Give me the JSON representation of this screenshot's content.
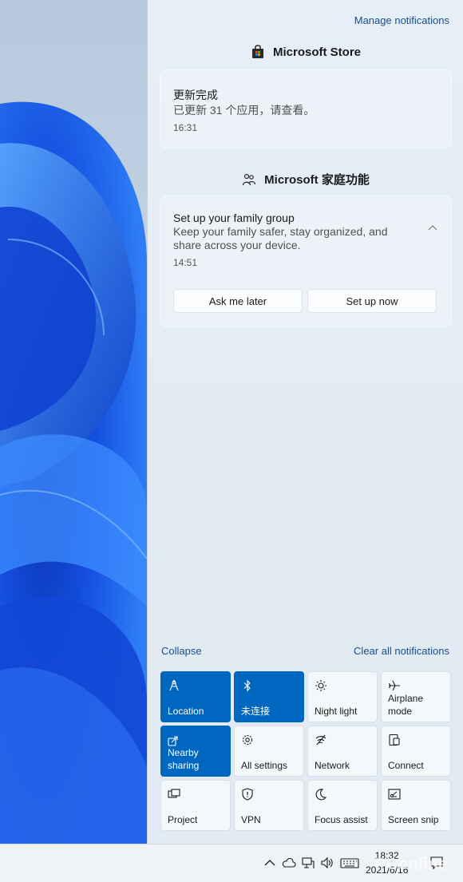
{
  "panel": {
    "manage_label": "Manage notifications",
    "collapse_label": "Collapse",
    "clear_all_label": "Clear all notifications"
  },
  "groups": [
    {
      "app": "Microsoft Store",
      "icon": "store-bag-icon",
      "notification": {
        "title": "更新完成",
        "body": "已更新 31 个应用，请查看。",
        "time": "16:31"
      }
    },
    {
      "app": "Microsoft 家庭功能",
      "icon": "family-icon",
      "notification": {
        "title": "Set up your family group",
        "body": "Keep your family safer, stay organized, and share across your device.",
        "time": "14:51",
        "buttons": [
          "Ask me later",
          "Set up now"
        ]
      }
    }
  ],
  "quick_actions": [
    {
      "label": "Location",
      "icon": "location-icon",
      "on": true
    },
    {
      "label": "未连接",
      "icon": "bluetooth-icon",
      "on": true
    },
    {
      "label": "Night light",
      "icon": "night-light-icon",
      "on": false
    },
    {
      "label": "Airplane mode",
      "icon": "airplane-icon",
      "on": false
    },
    {
      "label": "Nearby sharing",
      "icon": "nearby-sharing-icon",
      "on": true
    },
    {
      "label": "All settings",
      "icon": "gear-icon",
      "on": false
    },
    {
      "label": "Network",
      "icon": "network-icon",
      "on": false
    },
    {
      "label": "Connect",
      "icon": "connect-icon",
      "on": false
    },
    {
      "label": "Project",
      "icon": "project-icon",
      "on": false
    },
    {
      "label": "VPN",
      "icon": "vpn-icon",
      "on": false
    },
    {
      "label": "Focus assist",
      "icon": "focus-assist-icon",
      "on": false
    },
    {
      "label": "Screen snip",
      "icon": "screen-snip-icon",
      "on": false
    }
  ],
  "taskbar": {
    "time": "18:32",
    "date": "2021/6/16",
    "watermark": "PConline",
    "tray_icons": [
      "chevron-up-icon",
      "onedrive-icon",
      "network-icon",
      "volume-icon",
      "keyboard-icon",
      "notification-icon"
    ]
  },
  "colors": {
    "accent": "#0067c0",
    "panel_bg": "#e6eef7",
    "link": "#1a4e8a"
  }
}
